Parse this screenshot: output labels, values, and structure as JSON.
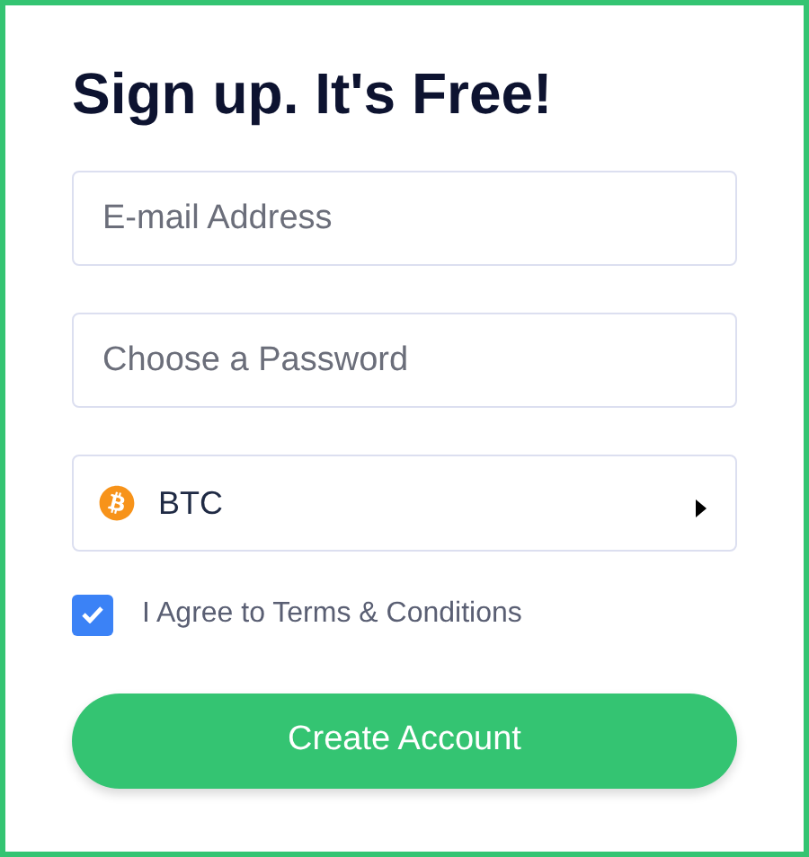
{
  "title": "Sign up. It's Free!",
  "fields": [
    {
      "placeholder": "E-mail Address"
    },
    {
      "placeholder": "Choose a Password"
    }
  ],
  "currency": {
    "value": "BTC"
  },
  "terms": {
    "label": "I Agree to Terms & Conditions",
    "checked": true
  },
  "submit": {
    "label": "Create Account"
  }
}
